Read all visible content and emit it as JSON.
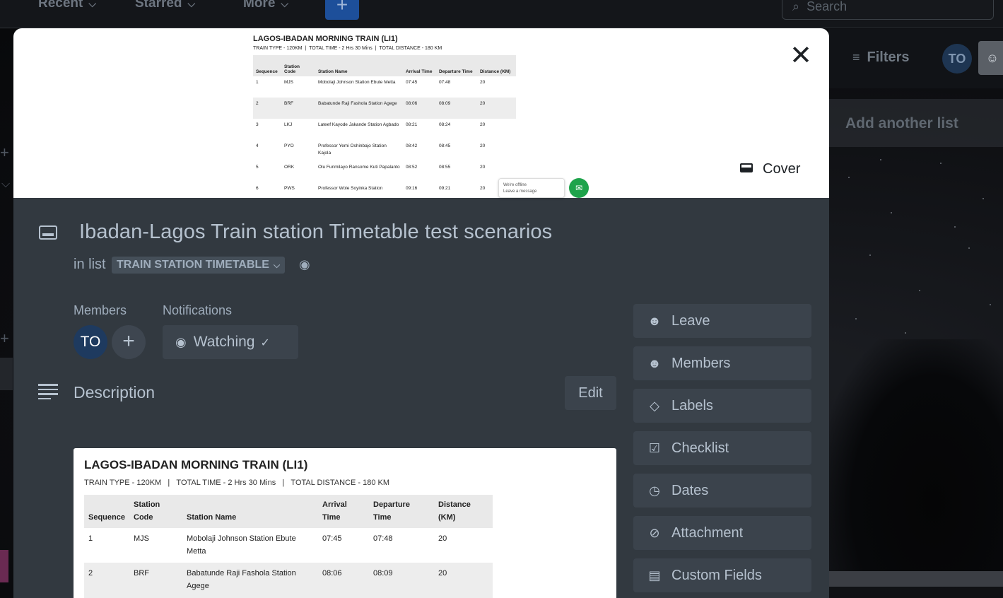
{
  "topbar": {
    "recent": "Recent",
    "starred": "Starred",
    "more": "More",
    "create": "+",
    "search_placeholder": "Search"
  },
  "board": {
    "filters": "Filters",
    "avatar_initials": "TO",
    "add_list": "Add another list"
  },
  "card": {
    "title": "Ibadan-Lagos Train station Timetable test scenarios",
    "in_list_prefix": "in list",
    "list_name": "TRAIN STATION TIMETABLE",
    "cover_label": "Cover",
    "members_label": "Members",
    "notifications_label": "Notifications",
    "member_initials": "TO",
    "watching_label": "Watching",
    "description_title": "Description",
    "edit_label": "Edit"
  },
  "timetable": {
    "title": "LAGOS-IBADAN MORNING TRAIN (LI1)",
    "subtitle_type": "TRAIN TYPE - 120KM",
    "subtitle_time": "TOTAL TIME - 2 Hrs 30 Mins",
    "subtitle_distance": "TOTAL DISTANCE - 180 KM",
    "headers": [
      "Sequence",
      "Station Code",
      "Station Name",
      "Arrival Time",
      "Departure Time",
      "Distance (KM)"
    ],
    "rows": [
      [
        "1",
        "MJS",
        "Mobolaji Johnson Station Ebute Metta",
        "07:45",
        "07:48",
        "20"
      ],
      [
        "2",
        "BRF",
        "Babatunde Raji Fashola Station Agege",
        "08:06",
        "08:09",
        "20"
      ],
      [
        "3",
        "LKJ",
        "Lateef Kayode Jakande Station Agbado",
        "08:21",
        "08:24",
        "20"
      ],
      [
        "4",
        "PYO",
        "Professor Yemi Oshinbajo Station Kajola",
        "08:42",
        "08:45",
        "20"
      ],
      [
        "5",
        "ORK",
        "Olu Funmilayo Ransome Kuti Papalanto",
        "08:52",
        "08:55",
        "20"
      ],
      [
        "6",
        "PWS",
        "Professor Wole Soyinka Station",
        "09:16",
        "09:21",
        "20"
      ]
    ],
    "chat_offline": "We're offline",
    "chat_leave": "Leave a message"
  },
  "actions": [
    {
      "icon": "person-icon",
      "label": "Leave"
    },
    {
      "icon": "person-icon",
      "label": "Members"
    },
    {
      "icon": "tag-icon",
      "label": "Labels"
    },
    {
      "icon": "checkbox-icon",
      "label": "Checklist"
    },
    {
      "icon": "clock-icon",
      "label": "Dates"
    },
    {
      "icon": "paperclip-icon",
      "label": "Attachment"
    },
    {
      "icon": "fields-icon",
      "label": "Custom Fields"
    }
  ]
}
